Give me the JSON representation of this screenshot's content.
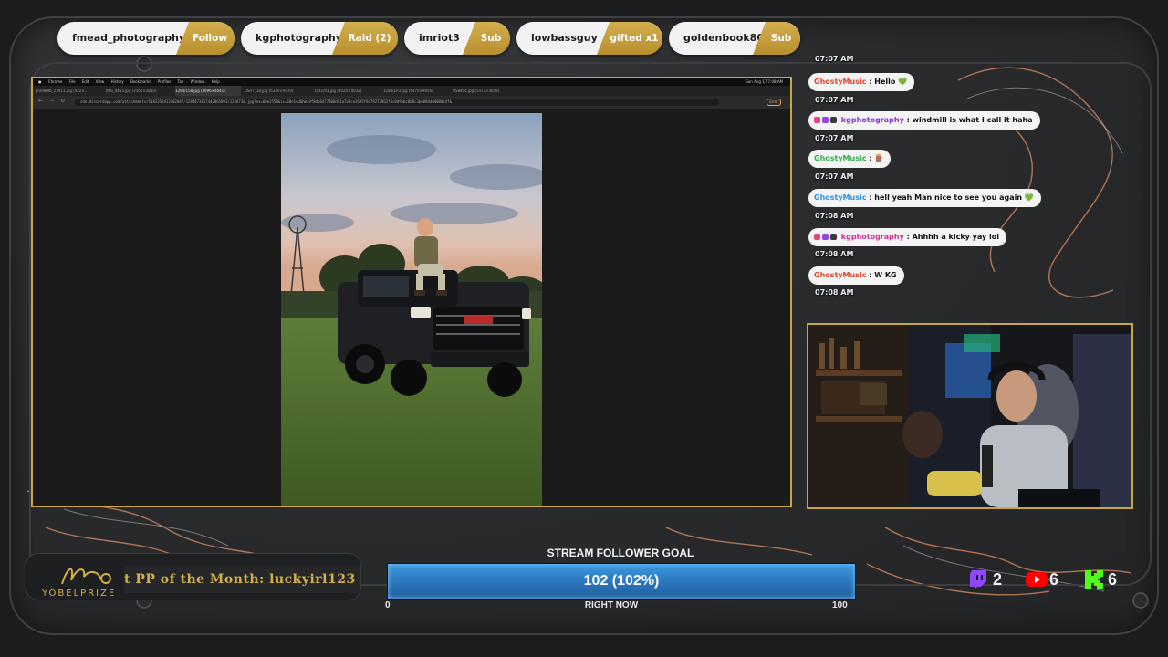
{
  "alerts": [
    {
      "name": "fmead_photography",
      "action": "Follow"
    },
    {
      "name": "kgphotography",
      "action": "Raid (2)"
    },
    {
      "name": "imriot3",
      "action": "Sub"
    },
    {
      "name": "lowbassguy",
      "action": "gifted x1"
    },
    {
      "name": "goldenbook80",
      "action": "Sub"
    }
  ],
  "browser": {
    "menu": [
      "Chrome",
      "File",
      "Edit",
      "View",
      "History",
      "Bookmarks",
      "Profiles",
      "Tab",
      "Window",
      "Help"
    ],
    "clock": "Sun Aug 17  7:08 AM",
    "tabs": [
      "JR0989b_23911.jpg (922×...",
      "IMG_4455.jpg (2160×3840)",
      "1294/158.jpg (3096×4641)",
      "USA7_18.jpg (6336×9170)",
      "1041/01.jpg (3024×4032)",
      "1284/1P3.jpg (6470×9856)",
      "US8404.jpg (5472×3648)"
    ],
    "url": "cdn.discordapp.com/attachments/1183352413402047/1284473837442865893/1284738.jpg?ex=68e2558&is=68e14d&hm=9f8db6d77300d91a7a0ce2695f8d79273862f4c0d9bbc0b8c3be084dd4000c4f&",
    "page_label": "Error"
  },
  "chat": {
    "top_timestamp": "07:07 AM",
    "messages": [
      {
        "user": "GhostyMusic",
        "color_class": "user-red",
        "text": "Hello 💚",
        "time": "07:07 AM",
        "badges": false
      },
      {
        "user": "kgphotography",
        "color_class": "user-purple",
        "text": "windmill is what I call it haha",
        "time": "07:07 AM",
        "badges": true
      },
      {
        "user": "GhostyMusic",
        "color_class": "user-green",
        "text": "🪵",
        "time": "07:07 AM",
        "badges": false
      },
      {
        "user": "GhostyMusic",
        "color_class": "user-blue",
        "text": "hell yeah Man nice to see you again 💚",
        "time": "07:08 AM",
        "badges": false
      },
      {
        "user": "kgphotography",
        "color_class": "user-pink",
        "text": "Ahhhh a kicky yay lol",
        "time": "07:08 AM",
        "badges": true
      },
      {
        "user": "GhostyMusic",
        "color_class": "user-red",
        "text": "W KG",
        "time": "07:08 AM",
        "badges": false
      }
    ]
  },
  "potm": {
    "text": "t PP of the Month: luckyirl123",
    "brand": "YOBELPRIZE"
  },
  "goal": {
    "title": "STREAM FOLLOWER GOAL",
    "count": "102 (102%)",
    "progress": 1.0,
    "min": "0",
    "max": "100",
    "sub": "RIGHT NOW"
  },
  "social": {
    "twitch": {
      "count": "2",
      "color": "#9146ff"
    },
    "youtube": {
      "count": "6",
      "color": "#ff0000"
    },
    "kick": {
      "count": "6",
      "color": "#53fc18"
    }
  },
  "colors": {
    "gold": "#c9a63f",
    "goal_blue": "#2d7bc2"
  }
}
